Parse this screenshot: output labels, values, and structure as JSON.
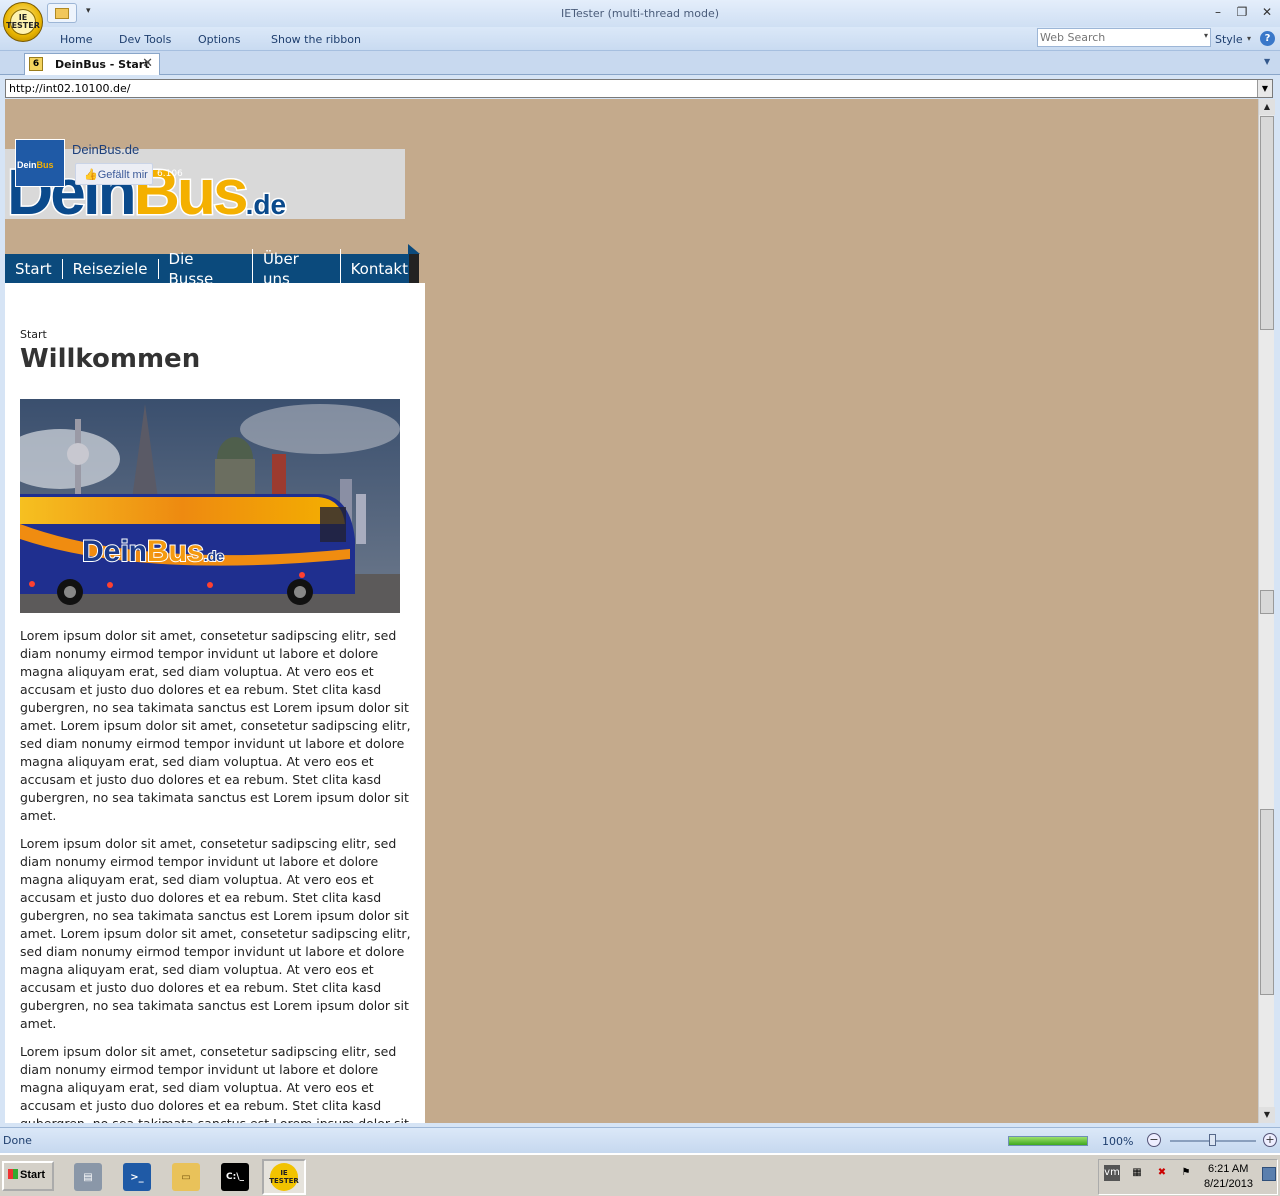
{
  "window": {
    "title": "IETester (multi-thread mode)",
    "orb_text": "IE\nTESTER"
  },
  "ribbon": {
    "tabs": [
      "Home",
      "Dev Tools",
      "Options",
      "Show the ribbon"
    ],
    "search_placeholder": "Web Search",
    "style_label": "Style",
    "help": "?"
  },
  "doc_tab": {
    "version": "6",
    "title": "DeinBus - Start",
    "close": "✕"
  },
  "address": {
    "url": "http://int02.10100.de/"
  },
  "site": {
    "logo": {
      "dein": "Dein",
      "bus": "Bus",
      "tld": ".de"
    },
    "fb_widget": {
      "page_name": "DeinBus.de",
      "thumb_dein": "Dein",
      "thumb_bus": "Bus",
      "like_label": "Gefällt mir",
      "count": "6.106"
    },
    "nav": [
      "Start",
      "Reiseziele",
      "Die Busse",
      "Über uns",
      "Kontakt"
    ],
    "breadcrumb": "Start",
    "headline": "Willkommen",
    "hero_caption": {
      "dein": "Dein",
      "bus": "Bus",
      "tld": ".de"
    },
    "paragraphs": [
      "Lorem ipsum dolor sit amet, consetetur sadipscing elitr, sed diam nonumy eirmod tempor invidunt ut labore et dolore magna aliquyam erat, sed diam voluptua. At vero eos et accusam et justo duo dolores et ea rebum. Stet clita kasd gubergren, no sea takimata sanctus est Lorem ipsum dolor sit amet. Lorem ipsum dolor sit amet, consetetur sadipscing elitr, sed diam nonumy eirmod tempor invidunt ut labore et dolore magna aliquyam erat, sed diam voluptua. At vero eos et accusam et justo duo dolores et ea rebum. Stet clita kasd gubergren, no sea takimata sanctus est Lorem ipsum dolor sit amet.",
      "Lorem ipsum dolor sit amet, consetetur sadipscing elitr, sed diam nonumy eirmod tempor invidunt ut labore et dolore magna aliquyam erat, sed diam voluptua. At vero eos et accusam et justo duo dolores et ea rebum. Stet clita kasd gubergren, no sea takimata sanctus est Lorem ipsum dolor sit amet. Lorem ipsum dolor sit amet, consetetur sadipscing elitr, sed diam nonumy eirmod tempor invidunt ut labore et dolore magna aliquyam erat, sed diam voluptua. At vero eos et accusam et justo duo dolores et ea rebum. Stet clita kasd gubergren, no sea takimata sanctus est Lorem ipsum dolor sit amet.",
      "Lorem ipsum dolor sit amet, consetetur sadipscing elitr, sed diam nonumy eirmod tempor invidunt ut labore et dolore magna aliquyam erat, sed diam voluptua. At vero eos et accusam et justo duo dolores et ea rebum. Stet clita kasd gubergren, no sea takimata sanctus est Lorem ipsum dolor sit amet."
    ]
  },
  "statusbar": {
    "status": "Done",
    "progress": 1.0,
    "zoom": "100%",
    "zoom_minus": "−",
    "zoom_plus": "+"
  },
  "taskbar": {
    "start_label": "Start",
    "apps": [
      "server-manager-icon",
      "powershell-icon",
      "explorer-folder-icon",
      "command-prompt-icon",
      "ietester-icon"
    ],
    "cmd_text": "C:\\_",
    "ietester_text": "IE\nTESTER",
    "clock_time": "6:21 AM",
    "clock_date": "8/21/2013",
    "tray_icons": [
      "vmware-icon",
      "network-icon",
      "volume-muted-icon",
      "action-center-flag-icon"
    ]
  },
  "colors": {
    "page_background": "#c4aa8c",
    "nav_blue": "#0b4a7c",
    "brand_yellow": "#f4b000"
  }
}
